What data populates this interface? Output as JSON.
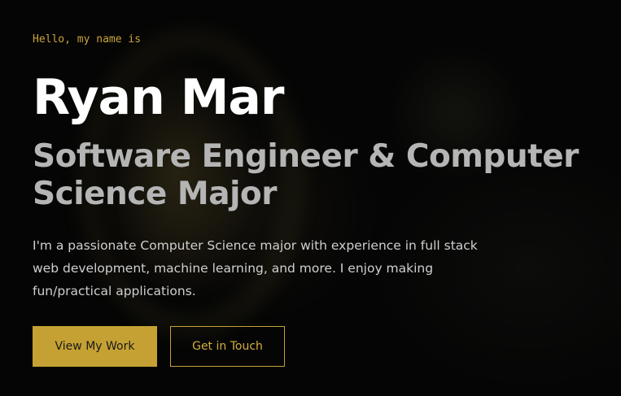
{
  "hero": {
    "greeting": "Hello, my name is",
    "name": "Ryan Mar",
    "role": "Software Engineer & Computer Science Major",
    "bio": "I'm a passionate Computer Science major with experience in full stack web development, machine learning, and more. I enjoy making fun/practical applications.",
    "primary_button_label": "View My Work",
    "secondary_button_label": "Get in Touch"
  },
  "colors": {
    "background": "#050505",
    "accent": "#c5a134",
    "heading": "#ffffff",
    "subheading": "#b5b5b5",
    "body_text": "#cfcfcf"
  }
}
